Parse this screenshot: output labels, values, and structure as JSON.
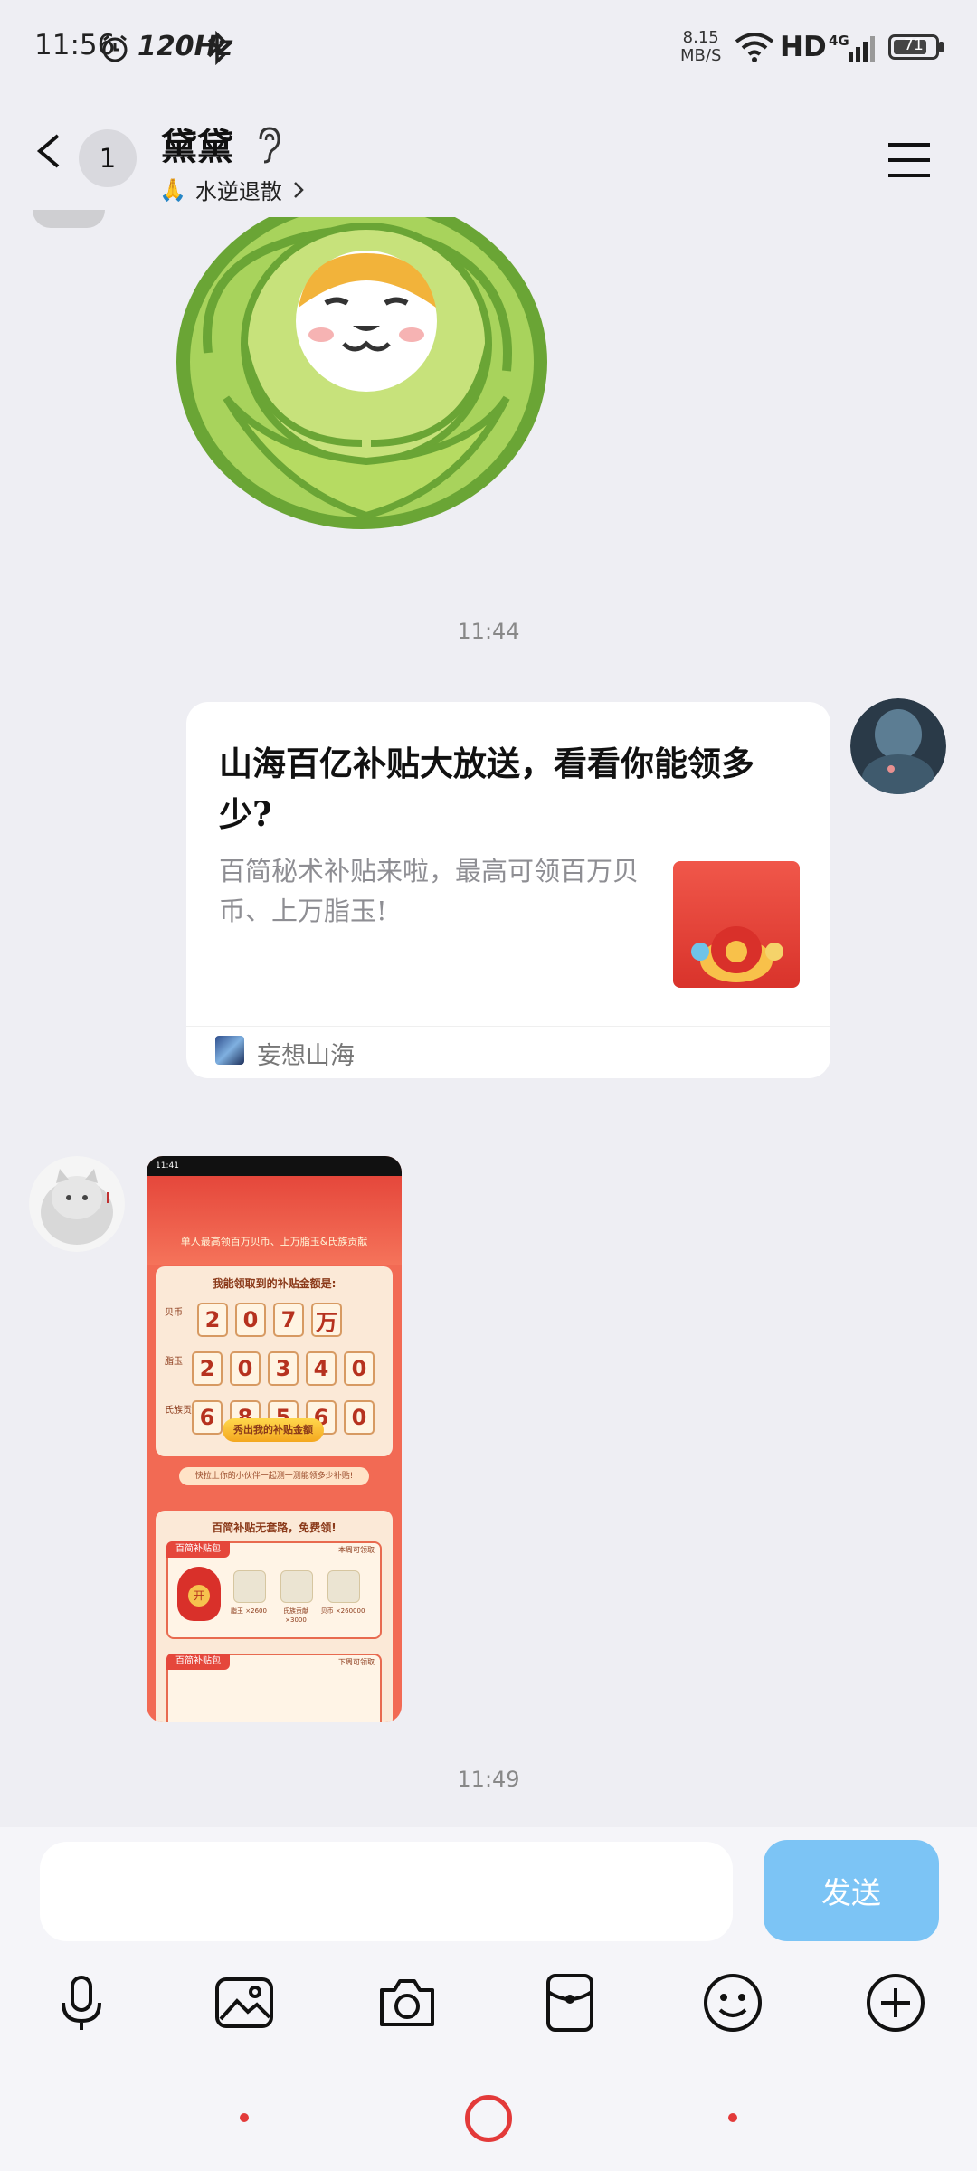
{
  "status_bar": {
    "time": "11:56",
    "refresh_rate": "120Hz",
    "net_speed_value": "8.15",
    "net_speed_unit": "MB/S",
    "hd": "HD",
    "signal_type": "4G",
    "battery": "71"
  },
  "header": {
    "back_count": "1",
    "title": "黛黛",
    "subtitle": "水逆退散",
    "subtitle_emoji": "🙏"
  },
  "messages": {
    "timestamp_1": "11:44",
    "card": {
      "title": "山海百亿补贴大放送，看看你能领多少?",
      "description": "百简秘术补贴来啦，最高可领百万贝币、上万脂玉!",
      "source": "妄想山海"
    },
    "timestamp_2": "11:49"
  },
  "shared_screenshot": {
    "status_time": "11:41",
    "banner_text": "单人最高领百万贝币、上万脂玉&氏族贡献",
    "panel_title": "我能领取到的补贴金额是:",
    "rows": [
      {
        "label": "贝币",
        "digits": [
          "2",
          "0",
          "7",
          "万"
        ]
      },
      {
        "label": "脂玉",
        "digits": [
          "2",
          "0",
          "3",
          "4",
          "0"
        ]
      },
      {
        "label": "氏族贡献",
        "digits": [
          "6",
          "8",
          "5",
          "6",
          "0"
        ]
      }
    ],
    "cta": "秀出我的补贴金额",
    "hint": "快拉上你的小伙伴一起测一测能领多少补贴!",
    "section_title": "百简补贴无套路，免费领!",
    "packs": [
      {
        "tag": "百简补贴包",
        "status": "本周可领取",
        "items": [
          "脂玉 ×2600",
          "氏族贡献 ×3000",
          "贝币 ×260000"
        ]
      },
      {
        "tag": "百简补贴包",
        "status": "下周可领取",
        "items": []
      }
    ]
  },
  "input": {
    "placeholder": "",
    "send_label": "发送"
  },
  "colors": {
    "background": "#EEEEF3",
    "send_button": "#7CC4F5",
    "nav_accent": "#E33A3A"
  }
}
